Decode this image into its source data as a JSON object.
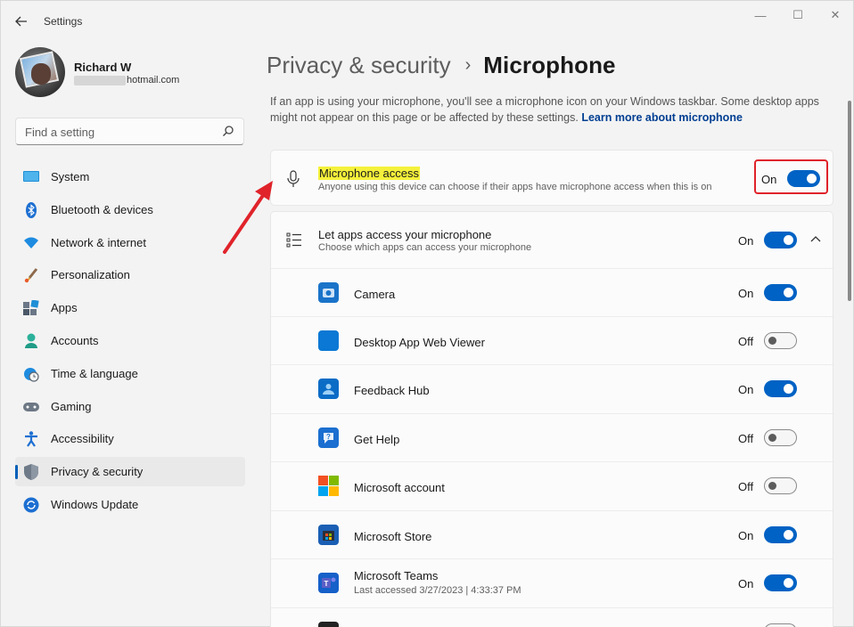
{
  "window": {
    "title": "Settings",
    "back_icon": "back-arrow-icon",
    "min_glyph": "—",
    "max_glyph": "☐",
    "close_glyph": "✕"
  },
  "profile": {
    "name": "Richard W",
    "email_suffix": "hotmail.com"
  },
  "search": {
    "placeholder": "Find a setting",
    "icon": "search-icon"
  },
  "sidebar": {
    "items": [
      {
        "label": "System",
        "icon": "system-icon",
        "active": false
      },
      {
        "label": "Bluetooth & devices",
        "icon": "bluetooth-icon",
        "active": false
      },
      {
        "label": "Network & internet",
        "icon": "wifi-icon",
        "active": false
      },
      {
        "label": "Personalization",
        "icon": "brush-icon",
        "active": false
      },
      {
        "label": "Apps",
        "icon": "apps-icon",
        "active": false
      },
      {
        "label": "Accounts",
        "icon": "accounts-icon",
        "active": false
      },
      {
        "label": "Time & language",
        "icon": "globe-clock-icon",
        "active": false
      },
      {
        "label": "Gaming",
        "icon": "gamepad-icon",
        "active": false
      },
      {
        "label": "Accessibility",
        "icon": "accessibility-icon",
        "active": false
      },
      {
        "label": "Privacy & security",
        "icon": "shield-icon",
        "active": true
      },
      {
        "label": "Windows Update",
        "icon": "update-icon",
        "active": false
      }
    ]
  },
  "breadcrumb": {
    "parent": "Privacy & security",
    "separator": "›",
    "current": "Microphone"
  },
  "description": {
    "text": "If an app is using your microphone, you'll see a microphone icon on your Windows taskbar. Some desktop apps might not appear on this page or be affected by these settings.",
    "link": "Learn more about microphone"
  },
  "microphone_access": {
    "title": "Microphone access",
    "subtitle": "Anyone using this device can choose if their apps have microphone access when this is on",
    "state": "On",
    "toggle_on": true,
    "icon": "microphone-icon"
  },
  "let_apps": {
    "title": "Let apps access your microphone",
    "subtitle": "Choose which apps can access your microphone",
    "state": "On",
    "toggle_on": true,
    "icon": "list-icon",
    "chevron": "chevron-up-icon"
  },
  "apps": [
    {
      "name": "Camera",
      "sub": "",
      "state": "On",
      "on": true,
      "icon": "camera-app-icon",
      "color": "#1a73c9"
    },
    {
      "name": "Desktop App Web Viewer",
      "sub": "",
      "state": "Off",
      "on": false,
      "icon": "web-viewer-app-icon",
      "color": "#0a78d4"
    },
    {
      "name": "Feedback Hub",
      "sub": "",
      "state": "On",
      "on": true,
      "icon": "feedback-hub-app-icon",
      "color": "#0b6cc6"
    },
    {
      "name": "Get Help",
      "sub": "",
      "state": "Off",
      "on": false,
      "icon": "get-help-app-icon",
      "color": "#1b6fd0"
    },
    {
      "name": "Microsoft account",
      "sub": "",
      "state": "Off",
      "on": false,
      "icon": "microsoft-logo-icon",
      "color": "#f25022"
    },
    {
      "name": "Microsoft Store",
      "sub": "",
      "state": "On",
      "on": true,
      "icon": "store-app-icon",
      "color": "#1a5fb4"
    },
    {
      "name": "Microsoft Teams",
      "sub": "Last accessed 3/27/2023  |  4:33:37 PM",
      "state": "On",
      "on": true,
      "icon": "teams-app-icon",
      "color": "#1560c9"
    }
  ],
  "colors": {
    "accent": "#0062c4",
    "highlight": "#f5f13b",
    "annotation_red": "#e0232a"
  }
}
